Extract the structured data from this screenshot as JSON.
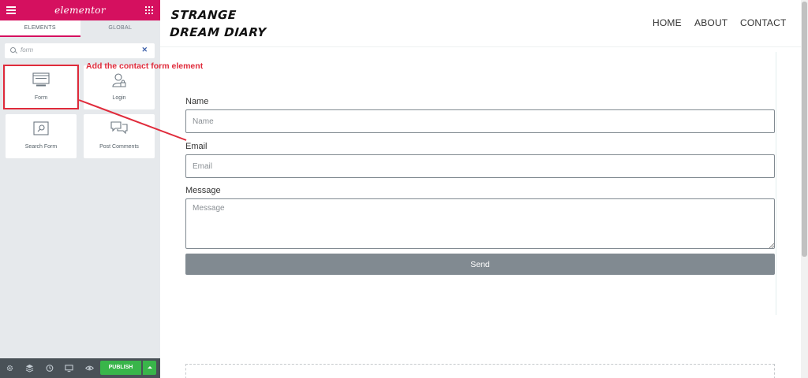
{
  "panel": {
    "brand": "elementor",
    "tabs": [
      "ELEMENTS",
      "GLOBAL"
    ],
    "search": {
      "value": "form",
      "clear_icon": "close-icon"
    },
    "widgets": [
      {
        "label": "Form",
        "icon": "form-icon"
      },
      {
        "label": "Login",
        "icon": "login-icon"
      },
      {
        "label": "Search Form",
        "icon": "search-form-icon"
      },
      {
        "label": "Post Comments",
        "icon": "post-comments-icon"
      }
    ],
    "footer": {
      "icons": [
        "settings-icon",
        "navigator-icon",
        "history-icon",
        "responsive-icon",
        "preview-icon"
      ],
      "publish_label": "PUBLISH"
    },
    "accent_color": "#d5105f",
    "publish_color": "#39b54a"
  },
  "annotation": {
    "text": "Add the contact form element",
    "color": "#e02b3b"
  },
  "site": {
    "logo": [
      "STRANGE",
      "DREAM DIARY"
    ],
    "nav": [
      "HOME",
      "ABOUT",
      "CONTACT"
    ],
    "form": {
      "fields": [
        {
          "label": "Name",
          "placeholder": "Name"
        },
        {
          "label": "Email",
          "placeholder": "Email"
        },
        {
          "label": "Message",
          "placeholder": "Message"
        }
      ],
      "submit_label": "Send",
      "button_color": "#818a91"
    }
  }
}
